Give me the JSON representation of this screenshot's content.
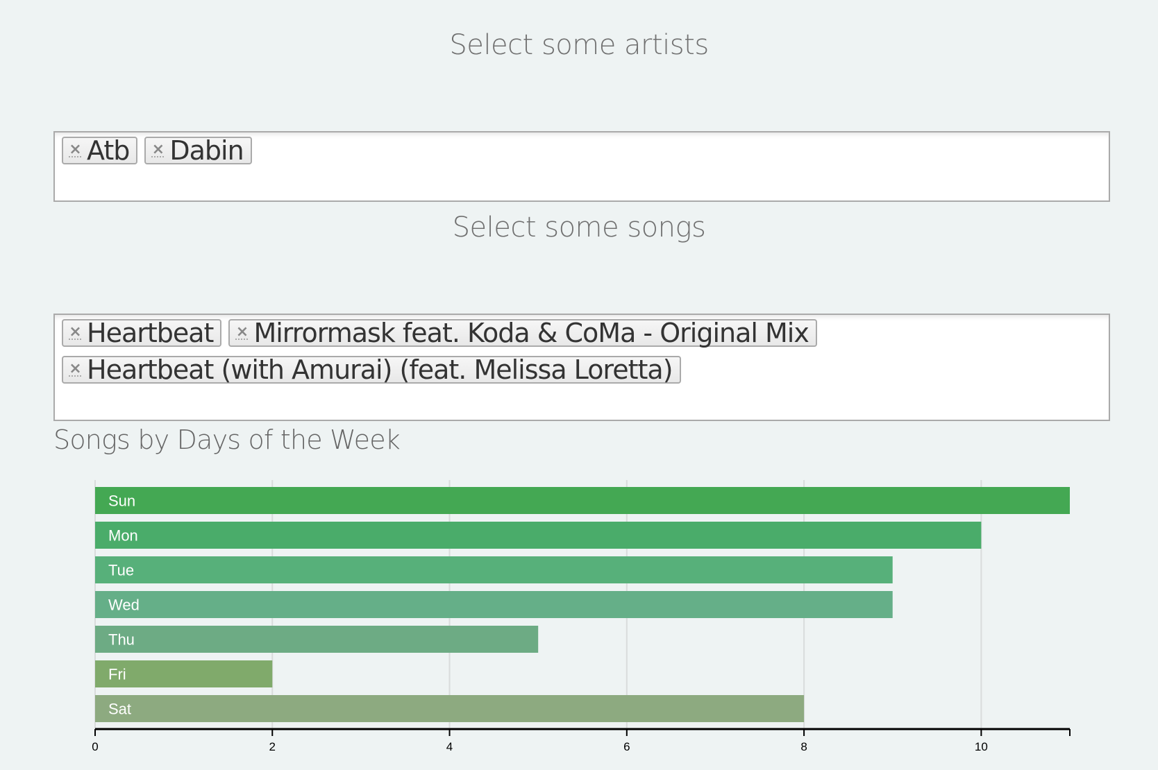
{
  "artists_section": {
    "title": "Select some artists",
    "selected": [
      "Atb",
      "Dabin"
    ]
  },
  "songs_section": {
    "title": "Select some songs",
    "selected": [
      "Heartbeat",
      "Mirrormask feat. Koda & CoMa - Original Mix",
      "Heartbeat (with Amurai) (feat. Melissa Loretta)"
    ]
  },
  "remove_glyph": "×",
  "chart_data": {
    "type": "bar",
    "orientation": "horizontal",
    "title": "Songs by Days of the Week",
    "categories": [
      "Sun",
      "Mon",
      "Tue",
      "Wed",
      "Thu",
      "Fri",
      "Sat"
    ],
    "values": [
      11,
      10,
      9,
      9,
      5,
      2,
      8
    ],
    "colors": [
      "#44a853",
      "#4aac6a",
      "#57b07a",
      "#65af88",
      "#6dab84",
      "#80aa6b",
      "#8daa80"
    ],
    "xlim": [
      0,
      11
    ],
    "xticks": [
      0,
      2,
      4,
      6,
      8,
      10
    ],
    "grid": true,
    "xlabel": "",
    "ylabel": ""
  }
}
